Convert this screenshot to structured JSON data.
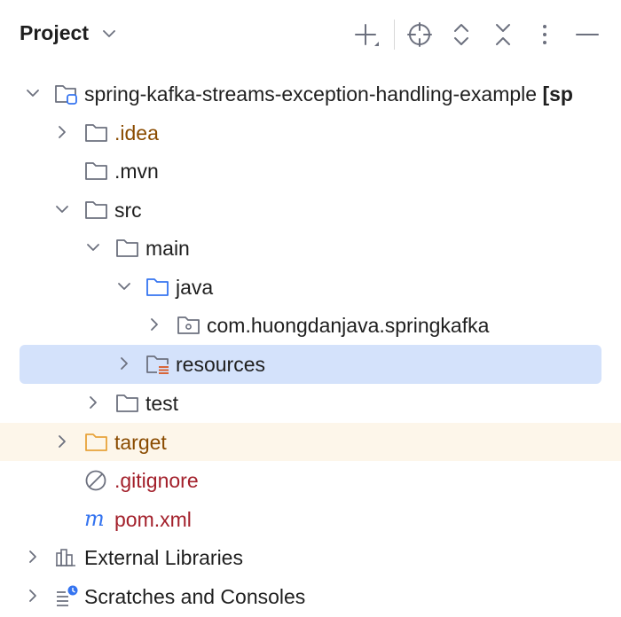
{
  "header": {
    "title": "Project"
  },
  "tree": {
    "root_name": "spring-kafka-streams-exception-handling-example",
    "root_suffix": "[sp",
    "idea": ".idea",
    "mvn": ".mvn",
    "src": "src",
    "main": "main",
    "java": "java",
    "package": "com.huongdanjava.springkafka",
    "resources": "resources",
    "test": "test",
    "target": "target",
    "gitignore": ".gitignore",
    "pom": "pom.xml",
    "external_libraries": "External Libraries",
    "scratches": "Scratches and Consoles"
  },
  "icons": {
    "module": "module-folder-icon",
    "folder": "folder-icon",
    "source_folder": "source-root-folder-icon",
    "package": "package-icon",
    "resources_folder": "resources-root-folder-icon",
    "excluded_folder": "excluded-folder-icon",
    "ignore_file": "gitignore-file-icon",
    "maven_file": "maven-pom-icon",
    "libraries": "external-libraries-icon",
    "scratches": "scratches-icon"
  },
  "colors": {
    "selection": "#d4e2fb",
    "excluded_row": "#fdf6ea",
    "excluded_text": "#8a4b00",
    "vcs_ignored_text": "#a3202b",
    "source_folder_blue": "#3574f0",
    "excluded_folder_orange": "#e8a33b"
  }
}
